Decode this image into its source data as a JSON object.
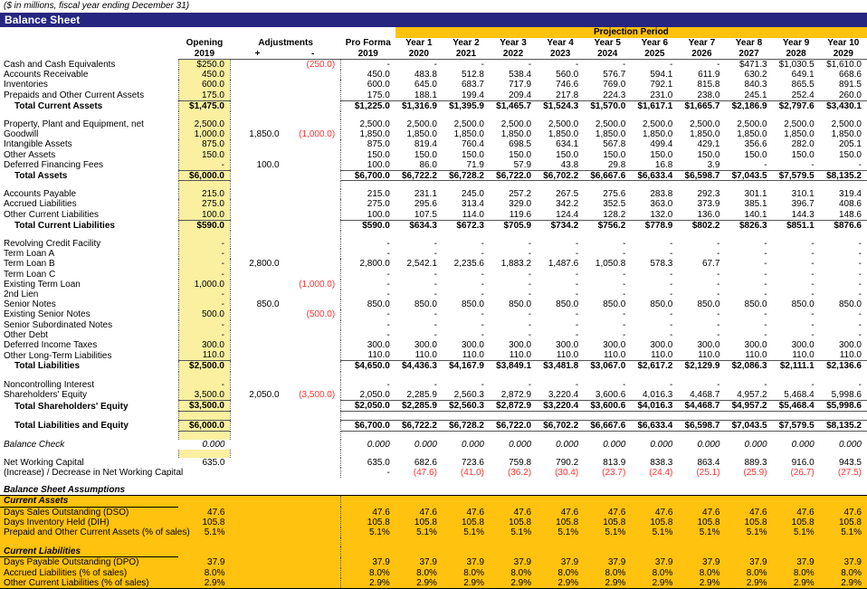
{
  "caption": "($ in millions, fiscal year ending December 31)",
  "title": "Balance Sheet",
  "colors": {
    "title_bg": "#262680",
    "projection_bg": "#ffc20e",
    "input_cell": "#faf0a0",
    "negative": "#ff3333"
  },
  "header": {
    "projection_label": "Projection Period",
    "opening": [
      "Opening",
      "2019"
    ],
    "adjustments": [
      "Adjustments",
      "+",
      "-"
    ],
    "pro_forma": [
      "Pro Forma",
      "2019"
    ],
    "years": [
      [
        "Year 1",
        "2020"
      ],
      [
        "Year 2",
        "2021"
      ],
      [
        "Year 3",
        "2022"
      ],
      [
        "Year 4",
        "2023"
      ],
      [
        "Year 5",
        "2024"
      ],
      [
        "Year 6",
        "2025"
      ],
      [
        "Year 7",
        "2026"
      ],
      [
        "Year 8",
        "2027"
      ],
      [
        "Year 9",
        "2028"
      ],
      [
        "Year 10",
        "2029"
      ]
    ]
  },
  "rows": [
    {
      "label": "Cash and Cash Equivalents",
      "open": "$250.0",
      "adj_p": "",
      "adj_m": "(250.0)",
      "adj_m_neg": true,
      "pf": "-",
      "years": [
        "-",
        "-",
        "-",
        "-",
        "-",
        "-",
        "-",
        "$471.3",
        "$1,030.5",
        "$1,610.0"
      ]
    },
    {
      "label": "Accounts Receivable",
      "open": "450.0",
      "adj_p": "",
      "adj_m": "",
      "pf": "450.0",
      "years": [
        "483.8",
        "512.8",
        "538.4",
        "560.0",
        "576.7",
        "594.1",
        "611.9",
        "630.2",
        "649.1",
        "668.6"
      ]
    },
    {
      "label": "Inventories",
      "open": "600.0",
      "adj_p": "",
      "adj_m": "",
      "pf": "600.0",
      "years": [
        "645.0",
        "683.7",
        "717.9",
        "746.6",
        "769.0",
        "792.1",
        "815.8",
        "840.3",
        "865.5",
        "891.5"
      ]
    },
    {
      "label": "Prepaids and Other Current Assets",
      "open": "175.0",
      "adj_p": "",
      "adj_m": "",
      "pf": "175.0",
      "years": [
        "188.1",
        "199.4",
        "209.4",
        "217.8",
        "224.3",
        "231.0",
        "238.0",
        "245.1",
        "252.4",
        "260.0"
      ],
      "underline": true
    },
    {
      "label": "Total Current Assets",
      "open": "$1,475.0",
      "adj_p": "",
      "adj_m": "",
      "pf": "$1,225.0",
      "years": [
        "$1,316.9",
        "$1,395.9",
        "$1,465.7",
        "$1,524.3",
        "$1,570.0",
        "$1,617.1",
        "$1,665.7",
        "$2,186.9",
        "$2,797.6",
        "$3,430.1"
      ],
      "bold": true,
      "indent": true
    },
    {
      "spacer": true
    },
    {
      "label": "Property, Plant and Equipment, net",
      "open": "2,500.0",
      "adj_p": "",
      "adj_m": "",
      "pf": "2,500.0",
      "years": [
        "2,500.0",
        "2,500.0",
        "2,500.0",
        "2,500.0",
        "2,500.0",
        "2,500.0",
        "2,500.0",
        "2,500.0",
        "2,500.0",
        "2,500.0"
      ]
    },
    {
      "label": "Goodwill",
      "open": "1,000.0",
      "adj_p": "1,850.0",
      "adj_m": "(1,000.0)",
      "adj_m_neg": true,
      "pf": "1,850.0",
      "years": [
        "1,850.0",
        "1,850.0",
        "1,850.0",
        "1,850.0",
        "1,850.0",
        "1,850.0",
        "1,850.0",
        "1,850.0",
        "1,850.0",
        "1,850.0"
      ]
    },
    {
      "label": "Intangible Assets",
      "open": "875.0",
      "adj_p": "",
      "adj_m": "",
      "pf": "875.0",
      "years": [
        "819.4",
        "760.4",
        "698.5",
        "634.1",
        "567.8",
        "499.4",
        "429.1",
        "356.6",
        "282.0",
        "205.1"
      ]
    },
    {
      "label": "Other Assets",
      "open": "150.0",
      "adj_p": "",
      "adj_m": "",
      "pf": "150.0",
      "years": [
        "150.0",
        "150.0",
        "150.0",
        "150.0",
        "150.0",
        "150.0",
        "150.0",
        "150.0",
        "150.0",
        "150.0"
      ]
    },
    {
      "label": "Deferred Financing Fees",
      "open": "-",
      "adj_p": "100.0",
      "adj_m": "",
      "pf": "100.0",
      "years": [
        "86.0",
        "71.9",
        "57.9",
        "43.8",
        "29.8",
        "16.8",
        "3.9",
        "-",
        "-",
        "-"
      ],
      "underline": true
    },
    {
      "label": "Total Assets",
      "open": "$6,000.0",
      "adj_p": "",
      "adj_m": "",
      "pf": "$6,700.0",
      "years": [
        "$6,722.2",
        "$6,728.2",
        "$6,722.0",
        "$6,702.2",
        "$6,667.6",
        "$6,633.4",
        "$6,598.7",
        "$7,043.5",
        "$7,579.5",
        "$8,135.2"
      ],
      "bold": true,
      "indent": true,
      "double": true
    },
    {
      "spacer": true
    },
    {
      "label": "Accounts Payable",
      "open": "215.0",
      "adj_p": "",
      "adj_m": "",
      "pf": "215.0",
      "years": [
        "231.1",
        "245.0",
        "257.2",
        "267.5",
        "275.6",
        "283.8",
        "292.3",
        "301.1",
        "310.1",
        "319.4"
      ]
    },
    {
      "label": "Accrued Liabilities",
      "open": "275.0",
      "adj_p": "",
      "adj_m": "",
      "pf": "275.0",
      "years": [
        "295.6",
        "313.4",
        "329.0",
        "342.2",
        "352.5",
        "363.0",
        "373.9",
        "385.1",
        "396.7",
        "408.6"
      ]
    },
    {
      "label": "Other Current Liabilities",
      "open": "100.0",
      "adj_p": "",
      "adj_m": "",
      "pf": "100.0",
      "years": [
        "107.5",
        "114.0",
        "119.6",
        "124.4",
        "128.2",
        "132.0",
        "136.0",
        "140.1",
        "144.3",
        "148.6"
      ],
      "underline": true
    },
    {
      "label": "Total Current Liabilities",
      "open": "$590.0",
      "adj_p": "",
      "adj_m": "",
      "pf": "$590.0",
      "years": [
        "$634.3",
        "$672.3",
        "$705.9",
        "$734.2",
        "$756.2",
        "$778.9",
        "$802.2",
        "$826.3",
        "$851.1",
        "$876.6"
      ],
      "bold": true,
      "indent": true
    },
    {
      "spacer": true
    },
    {
      "label": "Revolving Credit Facility",
      "open": "-",
      "adj_p": "",
      "adj_m": "",
      "pf": "-",
      "years": [
        "-",
        "-",
        "-",
        "-",
        "-",
        "-",
        "-",
        "-",
        "-",
        "-"
      ]
    },
    {
      "label": "Term Loan A",
      "open": "-",
      "adj_p": "",
      "adj_m": "",
      "pf": "-",
      "years": [
        "-",
        "-",
        "-",
        "-",
        "-",
        "-",
        "-",
        "-",
        "-",
        "-"
      ]
    },
    {
      "label": "Term Loan B",
      "open": "-",
      "adj_p": "2,800.0",
      "adj_m": "",
      "pf": "2,800.0",
      "years": [
        "2,542.1",
        "2,235.6",
        "1,883.2",
        "1,487.6",
        "1,050.8",
        "578.3",
        "67.7",
        "-",
        "-",
        "-"
      ]
    },
    {
      "label": "Term Loan C",
      "open": "-",
      "adj_p": "",
      "adj_m": "",
      "pf": "-",
      "years": [
        "-",
        "-",
        "-",
        "-",
        "-",
        "-",
        "-",
        "-",
        "-",
        "-"
      ]
    },
    {
      "label": "Existing Term Loan",
      "open": "1,000.0",
      "adj_p": "",
      "adj_m": "(1,000.0)",
      "adj_m_neg": true,
      "pf": "-",
      "years": [
        "-",
        "-",
        "-",
        "-",
        "-",
        "-",
        "-",
        "-",
        "-",
        "-"
      ]
    },
    {
      "label": "2nd Lien",
      "open": "-",
      "adj_p": "",
      "adj_m": "",
      "pf": "-",
      "years": [
        "-",
        "-",
        "-",
        "-",
        "-",
        "-",
        "-",
        "-",
        "-",
        "-"
      ]
    },
    {
      "label": "Senior Notes",
      "open": "-",
      "adj_p": "850.0",
      "adj_m": "",
      "pf": "850.0",
      "years": [
        "850.0",
        "850.0",
        "850.0",
        "850.0",
        "850.0",
        "850.0",
        "850.0",
        "850.0",
        "850.0",
        "850.0"
      ]
    },
    {
      "label": "Existing Senior Notes",
      "open": "500.0",
      "adj_p": "",
      "adj_m": "(500.0)",
      "adj_m_neg": true,
      "pf": "-",
      "years": [
        "-",
        "-",
        "-",
        "-",
        "-",
        "-",
        "-",
        "-",
        "-",
        "-"
      ]
    },
    {
      "label": "Senior Subordinated Notes",
      "open": "-",
      "adj_p": "",
      "adj_m": "",
      "pf": "-",
      "years": [
        "-",
        "-",
        "-",
        "-",
        "-",
        "-",
        "-",
        "-",
        "-",
        "-"
      ]
    },
    {
      "label": "Other Debt",
      "open": "-",
      "adj_p": "",
      "adj_m": "",
      "pf": "-",
      "years": [
        "-",
        "-",
        "-",
        "-",
        "-",
        "-",
        "-",
        "-",
        "-",
        "-"
      ]
    },
    {
      "label": "Deferred Income Taxes",
      "open": "300.0",
      "adj_p": "",
      "adj_m": "",
      "pf": "300.0",
      "years": [
        "300.0",
        "300.0",
        "300.0",
        "300.0",
        "300.0",
        "300.0",
        "300.0",
        "300.0",
        "300.0",
        "300.0"
      ]
    },
    {
      "label": "Other Long-Term Liabilities",
      "open": "110.0",
      "adj_p": "",
      "adj_m": "",
      "pf": "110.0",
      "years": [
        "110.0",
        "110.0",
        "110.0",
        "110.0",
        "110.0",
        "110.0",
        "110.0",
        "110.0",
        "110.0",
        "110.0"
      ],
      "underline": true
    },
    {
      "label": "Total Liabilities",
      "open": "$2,500.0",
      "adj_p": "",
      "adj_m": "",
      "pf": "$4,650.0",
      "years": [
        "$4,436.3",
        "$4,167.9",
        "$3,849.1",
        "$3,481.8",
        "$3,067.0",
        "$2,617.2",
        "$2,129.9",
        "$2,086.3",
        "$2,111.1",
        "$2,136.6"
      ],
      "bold": true,
      "indent": true
    },
    {
      "spacer": true
    },
    {
      "label": "Noncontrolling Interest",
      "open": "-",
      "adj_p": "",
      "adj_m": "",
      "pf": "-",
      "years": [
        "-",
        "-",
        "-",
        "-",
        "-",
        "-",
        "-",
        "-",
        "-",
        "-"
      ]
    },
    {
      "label": "Shareholders' Equity",
      "open": "3,500.0",
      "adj_p": "2,050.0",
      "adj_m": "(3,500.0)",
      "adj_m_neg": true,
      "pf": "2,050.0",
      "years": [
        "2,285.9",
        "2,560.3",
        "2,872.9",
        "3,220.4",
        "3,600.6",
        "4,016.3",
        "4,468.7",
        "4,957.2",
        "5,468.4",
        "5,998.6"
      ],
      "underline": true
    },
    {
      "label": "Total Shareholders' Equity",
      "open": "$3,500.0",
      "adj_p": "",
      "adj_m": "",
      "pf": "$2,050.0",
      "years": [
        "$2,285.9",
        "$2,560.3",
        "$2,872.9",
        "$3,220.4",
        "$3,600.6",
        "$4,016.3",
        "$4,468.7",
        "$4,957.2",
        "$5,468.4",
        "$5,998.6"
      ],
      "bold": true,
      "indent": true,
      "underline": true
    },
    {
      "spacer": true
    },
    {
      "label": "Total Liabilities and Equity",
      "open": "$6,000.0",
      "adj_p": "",
      "adj_m": "",
      "pf": "$6,700.0",
      "years": [
        "$6,722.2",
        "$6,728.2",
        "$6,722.0",
        "$6,702.2",
        "$6,667.6",
        "$6,633.4",
        "$6,598.7",
        "$7,043.5",
        "$7,579.5",
        "$8,135.2"
      ],
      "bold": true,
      "indent": true,
      "double": true
    },
    {
      "spacer": true
    },
    {
      "label": "Balance Check",
      "open": "0.000",
      "adj_p": "",
      "adj_m": "",
      "pf": "0.000",
      "years": [
        "0.000",
        "0.000",
        "0.000",
        "0.000",
        "0.000",
        "0.000",
        "0.000",
        "0.000",
        "0.000",
        "0.000"
      ],
      "italic": true,
      "noinput": true
    },
    {
      "spacer": true
    },
    {
      "label": "Net Working Capital",
      "open": "635.0",
      "adj_p": "",
      "adj_m": "",
      "pf": "635.0",
      "years": [
        "682.6",
        "723.6",
        "759.8",
        "790.2",
        "813.9",
        "838.3",
        "863.4",
        "889.3",
        "916.0",
        "943.5"
      ],
      "noinput": true
    },
    {
      "label": "(Increase) / Decrease in Net Working Capital",
      "open": "",
      "adj_p": "",
      "adj_m": "",
      "pf": "-",
      "years": [
        "(47.6)",
        "(41.0)",
        "(36.2)",
        "(30.4)",
        "(23.7)",
        "(24.4)",
        "(25.1)",
        "(25.9)",
        "(26.7)",
        "(27.5)"
      ],
      "years_neg": true,
      "noinput": true
    }
  ],
  "assumptions": {
    "title": "Balance Sheet Assumptions",
    "sections": [
      {
        "heading": "Current Assets",
        "rows": [
          {
            "label": "Days Sales Outstanding (DSO)",
            "open": "47.6",
            "pf": "47.6",
            "years": [
              "47.6",
              "47.6",
              "47.6",
              "47.6",
              "47.6",
              "47.6",
              "47.6",
              "47.6",
              "47.6",
              "47.6"
            ]
          },
          {
            "label": "Days Inventory Held (DIH)",
            "open": "105.8",
            "pf": "105.8",
            "years": [
              "105.8",
              "105.8",
              "105.8",
              "105.8",
              "105.8",
              "105.8",
              "105.8",
              "105.8",
              "105.8",
              "105.8"
            ]
          },
          {
            "label": "Prepaid and Other Current Assets (% of sales)",
            "open": "5.1%",
            "pf": "5.1%",
            "years": [
              "5.1%",
              "5.1%",
              "5.1%",
              "5.1%",
              "5.1%",
              "5.1%",
              "5.1%",
              "5.1%",
              "5.1%",
              "5.1%"
            ]
          }
        ]
      },
      {
        "heading": "Current Liabilities",
        "rows": [
          {
            "label": "Days Payable Outstanding (DPO)",
            "open": "37.9",
            "pf": "37.9",
            "years": [
              "37.9",
              "37.9",
              "37.9",
              "37.9",
              "37.9",
              "37.9",
              "37.9",
              "37.9",
              "37.9",
              "37.9"
            ]
          },
          {
            "label": "Accrued Liabilities (% of sales)",
            "open": "8.0%",
            "pf": "8.0%",
            "years": [
              "8.0%",
              "8.0%",
              "8.0%",
              "8.0%",
              "8.0%",
              "8.0%",
              "8.0%",
              "8.0%",
              "8.0%",
              "8.0%"
            ]
          },
          {
            "label": "Other Current Liabilities (% of sales)",
            "open": "2.9%",
            "pf": "2.9%",
            "years": [
              "2.9%",
              "2.9%",
              "2.9%",
              "2.9%",
              "2.9%",
              "2.9%",
              "2.9%",
              "2.9%",
              "2.9%",
              "2.9%"
            ]
          }
        ]
      }
    ]
  }
}
